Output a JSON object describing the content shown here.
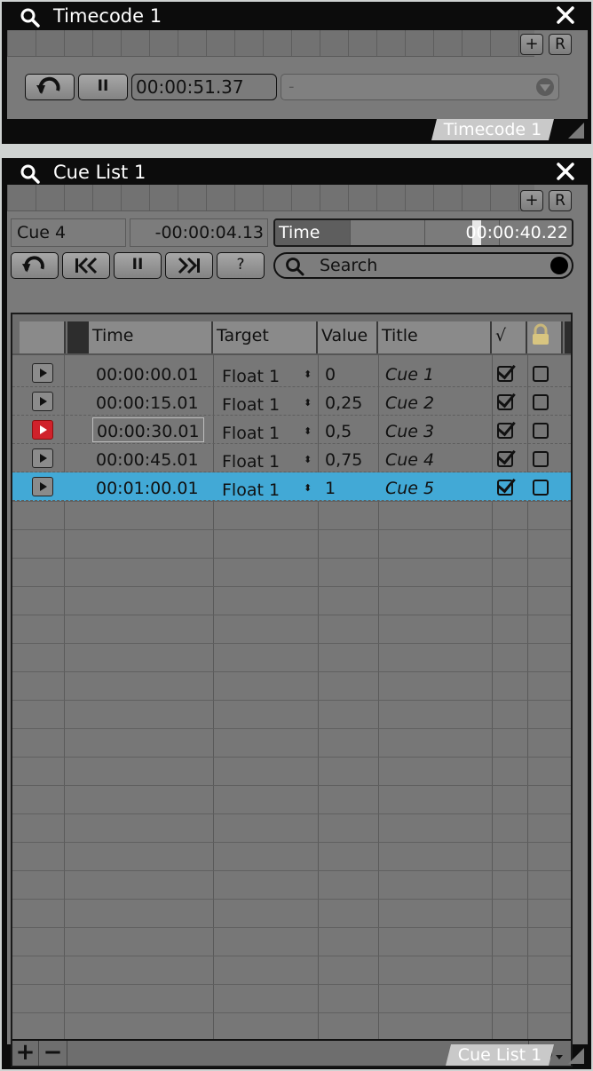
{
  "timecode_panel": {
    "title": "Timecode 1",
    "strip_add": "+",
    "strip_r": "R",
    "time_value": "00:00:51.37",
    "source_select": "-",
    "footer_tab": "Timecode 1",
    "icons": [
      "search-icon",
      "close-icon",
      "rewind-icon",
      "pause-icon",
      "chevron-down-icon",
      "resize-grip-icon"
    ]
  },
  "cue_panel": {
    "title": "Cue List 1",
    "strip_add": "+",
    "strip_r": "R",
    "current_cue": "Cue 4",
    "countdown": "-00:00:04.13",
    "time_label": "Time",
    "time_value": "00:00:40.22",
    "help_label": "?",
    "search_placeholder": "Search",
    "columns": [
      "Time",
      "Target",
      "Value",
      "Title",
      "√"
    ],
    "rows": [
      {
        "time": "00:00:00.01",
        "target": "Float 1",
        "value": "0",
        "title": "Cue 1",
        "enabled": true,
        "locked": false
      },
      {
        "time": "00:00:15.01",
        "target": "Float 1",
        "value": "0,25",
        "title": "Cue 2",
        "enabled": true,
        "locked": false
      },
      {
        "time": "00:00:30.01",
        "target": "Float 1",
        "value": "0,5",
        "title": "Cue 3",
        "enabled": true,
        "locked": false
      },
      {
        "time": "00:00:45.01",
        "target": "Float 1",
        "value": "0,75",
        "title": "Cue 4",
        "enabled": true,
        "locked": false
      },
      {
        "time": "00:01:00.01",
        "target": "Float 1",
        "value": "1",
        "title": "Cue 5",
        "enabled": true,
        "locked": false
      }
    ],
    "footer_add": "+",
    "footer_remove": "−",
    "footer_tab": "Cue List 1",
    "colors": {
      "selected_row": "#42a9d6",
      "active_cue": "#d0222b"
    }
  }
}
